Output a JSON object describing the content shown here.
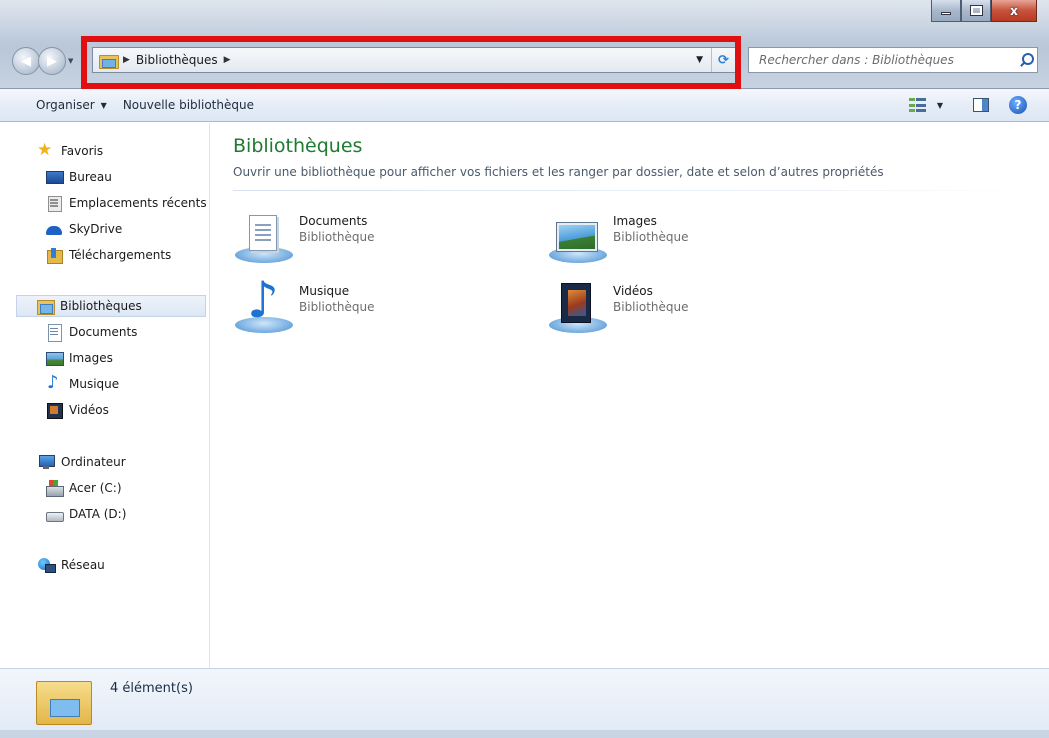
{
  "window": {
    "min_symbol": "",
    "max_symbol": "",
    "close_symbol": "x"
  },
  "nav_buttons": {
    "back_symbol": "◀",
    "forward_symbol": "▶"
  },
  "address": {
    "crumb": "Bibliothèques",
    "separator": "▶",
    "dropdown_symbol": "▼",
    "refresh_symbol": "⟳"
  },
  "search": {
    "placeholder": "Rechercher dans : Bibliothèques"
  },
  "command_bar": {
    "organize_label": "Organiser",
    "organize_caret": "▼",
    "new_library_label": "Nouvelle bibliothèque",
    "views_caret": "▼",
    "help_symbol": "?"
  },
  "nav_pane": {
    "favorites": {
      "label": "Favoris",
      "items": [
        {
          "label": "Bureau",
          "icon": "desktop-icon"
        },
        {
          "label": "Emplacements récents",
          "icon": "recent-places-icon"
        },
        {
          "label": "SkyDrive",
          "icon": "skydrive-icon"
        },
        {
          "label": "Téléchargements",
          "icon": "downloads-icon"
        }
      ]
    },
    "libraries": {
      "label": "Bibliothèques",
      "items": [
        {
          "label": "Documents",
          "icon": "documents-icon"
        },
        {
          "label": "Images",
          "icon": "pictures-icon"
        },
        {
          "label": "Musique",
          "icon": "music-icon"
        },
        {
          "label": "Vidéos",
          "icon": "videos-icon"
        }
      ]
    },
    "computer": {
      "label": "Ordinateur",
      "items": [
        {
          "label": "Acer (C:)",
          "icon": "drive-c-icon"
        },
        {
          "label": "DATA (D:)",
          "icon": "drive-d-icon"
        }
      ]
    },
    "network": {
      "label": "Réseau"
    }
  },
  "content": {
    "title": "Bibliothèques",
    "subtitle": "Ouvrir une bibliothèque pour afficher vos fichiers et les ranger par dossier, date et selon d’autres propriétés",
    "libraries": [
      {
        "name": "Documents",
        "type": "Bibliothèque"
      },
      {
        "name": "Images",
        "type": "Bibliothèque"
      },
      {
        "name": "Musique",
        "type": "Bibliothèque"
      },
      {
        "name": "Vidéos",
        "type": "Bibliothèque"
      }
    ]
  },
  "details": {
    "count": "4 élément(s)"
  },
  "colors": {
    "title_green": "#1e7b31",
    "highlight_red": "#e01010",
    "selection_blue": "#dde7f4"
  }
}
